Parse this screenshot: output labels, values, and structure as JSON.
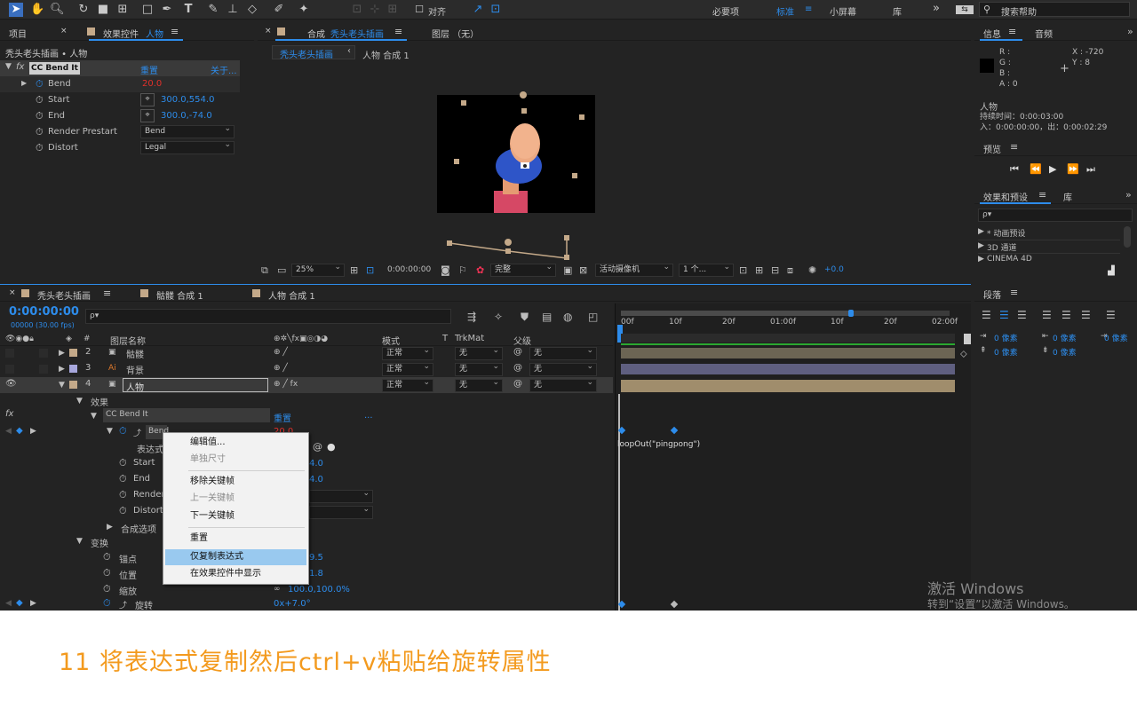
{
  "toolbar": {
    "align_label": "对齐",
    "workspaces": [
      "必要项",
      "标准",
      "小屏幕",
      "库"
    ],
    "active_workspace": "标准",
    "search_placeholder": "搜索帮助",
    "more": "»"
  },
  "project_panel": {
    "tab_project": "项目",
    "tab_effects_prefix": "效果控件",
    "tab_effects_layer": "人物",
    "breadcrumb": "秃头老头插画 • 人物",
    "effect_name": "CC Bend It",
    "reset": "重置",
    "about": "关于...",
    "properties": [
      {
        "name": "Bend",
        "value": "20.0",
        "type": "number"
      },
      {
        "name": "Start",
        "value": "300.0,554.0",
        "type": "point"
      },
      {
        "name": "End",
        "value": "300.0,-74.0",
        "type": "point"
      },
      {
        "name": "Render Prestart",
        "value": "Bend",
        "type": "select"
      },
      {
        "name": "Distort",
        "value": "Legal",
        "type": "select"
      }
    ]
  },
  "comp_panel": {
    "tab_prefix": "合成",
    "tab_comp": "秃头老头插画",
    "tab_layer": "图层 （无）",
    "crumb_active": "秃头老头插画",
    "crumb_next": "人物 合成 1",
    "zoom": "25%",
    "timecode": "0:00:00:00",
    "quality": "完整",
    "camera": "活动摄像机",
    "views": "1 个...",
    "exposure": "+0.0"
  },
  "info_panel": {
    "tab_info": "信息",
    "tab_audio": "音频",
    "r": "R :",
    "g": "G :",
    "b": "B :",
    "a": "A : 0",
    "x": "X : -720",
    "y": "Y : 8",
    "layer": "人物",
    "duration": "持续时间：0:00:03:00",
    "inout": "入：0:00:00:00，出：0:00:02:29"
  },
  "preview_panel": {
    "tab": "预览"
  },
  "effects_presets": {
    "tab": "效果和预设",
    "tab_lib": "库",
    "search_placeholder": "ρ▾",
    "items": [
      "* 动画预设",
      "3D 通道",
      "CINEMA 4D"
    ]
  },
  "paragraph_panel": {
    "tab": "段落",
    "indents": [
      "0 像素",
      "0 像素",
      "0 像素",
      "0 像素",
      "0 像素"
    ]
  },
  "timeline": {
    "tabs": [
      "秃头老头插画",
      "骷髅 合成 1",
      "人物 合成 1"
    ],
    "timecode": "0:00:00:00",
    "fps": "00000 (30.00 fps)",
    "search_placeholder": "ρ▾",
    "col_name": "图层名称",
    "col_mode": "模式",
    "col_t": "T",
    "col_trkmat": "TrkMat",
    "col_parent": "父级",
    "ruler": [
      "00f",
      "10f",
      "20f",
      "01:00f",
      "10f",
      "20f",
      "02:00f"
    ],
    "layers": [
      {
        "num": "2",
        "name": "骷髅",
        "mode": "正常",
        "trkmat": "无",
        "parent": "无"
      },
      {
        "num": "3",
        "name": "背景",
        "mode": "正常",
        "trkmat": "无",
        "parent": "无"
      },
      {
        "num": "4",
        "name": "人物",
        "mode": "正常",
        "trkmat": "无",
        "parent": "无"
      }
    ],
    "tree": {
      "effects": "效果",
      "effect_name": "CC Bend It",
      "reset": "重置",
      "dots": "...",
      "bend": "Bend",
      "bend_value": "20.0",
      "expr_label": "表达式",
      "start": "Start",
      "start_value": "4.0",
      "end": "End",
      "end_value": "4.0",
      "render": "Render",
      "distort": "Distort",
      "comp_options": "合成选项",
      "transform": "变换",
      "anchor": "锚点",
      "anchor_value": "9.5",
      "position": "位置",
      "position_value": "1.8",
      "scale": "缩放",
      "scale_value": "100.0,100.0%",
      "rotation": "旋转",
      "rotation_value": "0x+7.0°"
    },
    "expression": "loopOut(\"pingpong\")"
  },
  "context_menu": {
    "items": [
      {
        "label": "编辑值...",
        "disabled": false
      },
      {
        "label": "单独尺寸",
        "disabled": true
      },
      {
        "label": "移除关键帧",
        "disabled": false
      },
      {
        "label": "上一关键帧",
        "disabled": true
      },
      {
        "label": "下一关键帧",
        "disabled": false
      },
      {
        "label": "重置",
        "disabled": false
      },
      {
        "label": "仅复制表达式",
        "disabled": false,
        "selected": true
      },
      {
        "label": "在效果控件中显示",
        "disabled": false
      }
    ]
  },
  "watermark": {
    "line1": "激活 Windows",
    "line2": "转到“设置”以激活 Windows。"
  },
  "caption": "11 将表达式复制然后ctrl+v粘贴给旋转属性",
  "colors": {
    "accent_blue": "#2d8ceb",
    "value_red": "#e0302b",
    "caption_orange": "#f39a1e",
    "menu_highlight": "#99c9ef"
  }
}
